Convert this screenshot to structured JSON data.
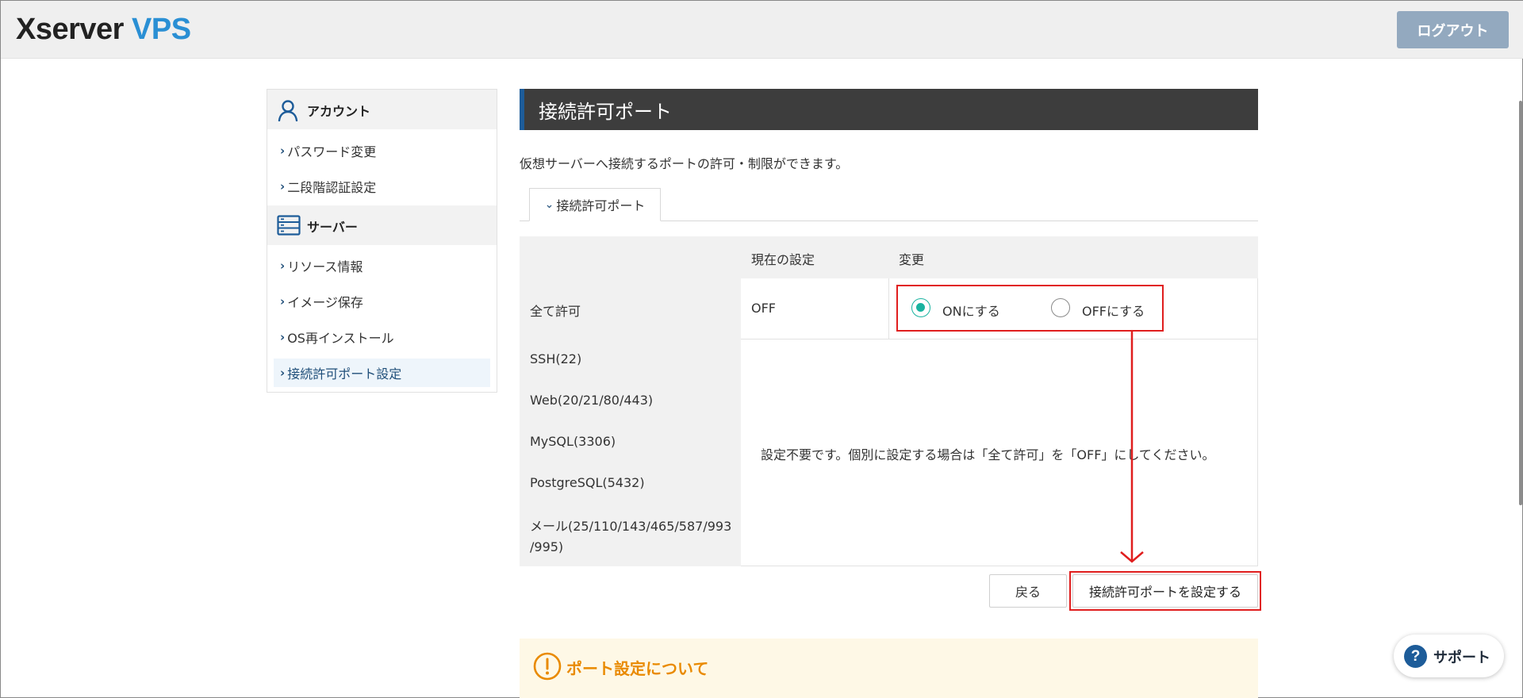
{
  "header": {
    "logo_part1": "Xserver",
    "logo_part2": "VPS",
    "logout_label": "ログアウト"
  },
  "sidebar": {
    "account_heading": "アカウント",
    "account_icon": "user-icon",
    "account_items": [
      {
        "label": "パスワード変更"
      },
      {
        "label": "二段階認証設定"
      }
    ],
    "server_heading": "サーバー",
    "server_icon": "server-icon",
    "server_items": [
      {
        "label": "リソース情報"
      },
      {
        "label": "イメージ保存"
      },
      {
        "label": "OS再インストール"
      },
      {
        "label": "接続許可ポート設定",
        "active": true
      }
    ]
  },
  "main": {
    "title": "接続許可ポート",
    "description": "仮想サーバーへ接続するポートの許可・制限ができます。",
    "tab_label": "接続許可ポート",
    "table": {
      "col_current": "現在の設定",
      "col_change": "変更",
      "all_allow": {
        "label": "全て許可",
        "current": "OFF",
        "option_on": "ONにする",
        "option_off": "OFFにする",
        "selected": "on"
      },
      "ports": [
        {
          "label": "SSH(22)"
        },
        {
          "label": "Web(20/21/80/443)"
        },
        {
          "label": "MySQL(3306)"
        },
        {
          "label": "PostgreSQL(5432)"
        },
        {
          "label": "メール(25/110/143/465/587/993/995)"
        }
      ],
      "mail_line1": "メール(25/110/143/465/587/993",
      "mail_line2": "/995)",
      "no_config_message": "設定不要です。個別に設定する場合は「全て許可」を「OFF」にしてください。"
    },
    "back_label": "戻る",
    "submit_label": "接続許可ポートを設定する"
  },
  "notice": {
    "title": "ポート設定について",
    "icon": "exclamation-circle-icon"
  },
  "support": {
    "label": "サポート",
    "icon": "question-circle-icon"
  },
  "colors": {
    "brand_blue": "#2a8fd4",
    "title_bar": "#3d3d3d",
    "accent_border": "#1d5c99",
    "radio_selected": "#19b3a0",
    "annotation_red": "#e01e1e",
    "notice_title": "#e98a00"
  }
}
